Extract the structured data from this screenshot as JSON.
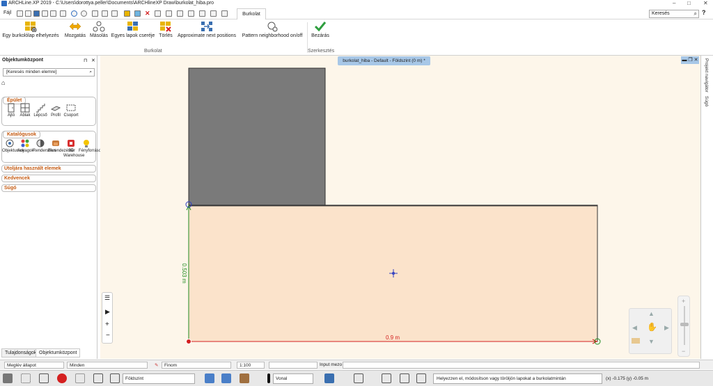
{
  "window": {
    "title": "ARCHLine.XP 2019 - C:\\Users\\dorottya.peller\\Documents\\ARCHlineXP Draw\\burkolat_hiba.pro",
    "min": "–",
    "max": "□",
    "close": "✕"
  },
  "quickbar": {
    "file_menu": "Fájl",
    "active_tab": "Burkolat",
    "search_placeholder": "Keresés",
    "help": "?"
  },
  "ribbon": {
    "buttons": [
      {
        "label": "Egy burkolólap elhelyezés",
        "icon": "tile-place-icon"
      },
      {
        "label": "Mozgatás",
        "icon": "move-arrows-icon"
      },
      {
        "label": "Másolás",
        "icon": "copy-nodes-icon"
      },
      {
        "label": "Egyes lapok cseréje",
        "icon": "tile-swap-icon"
      },
      {
        "label": "Törlés",
        "icon": "tile-delete-icon"
      },
      {
        "label": "Approximate next positions",
        "icon": "approx-positions-icon"
      },
      {
        "label": "Pattern neighborhood on/off",
        "icon": "pattern-toggle-icon"
      },
      {
        "label": "Bezárás",
        "icon": "checkmark-icon"
      }
    ],
    "group_burkolat": "Burkolat",
    "group_szerkesztes": "Szerkesztés"
  },
  "left_panel": {
    "title": "Objektumközpont",
    "pin": "⊓",
    "close": "✕",
    "search_placeholder": "[Keresés minden elemre]",
    "sections": {
      "epulet": "Épület",
      "katalogusok": "Katalógusok",
      "utoljara": "Utoljára használt elemek",
      "kedvencek": "Kedvencek",
      "sugo": "Súgó"
    },
    "epulet_items": [
      "Ajtó",
      "Ablak",
      "Lépcső",
      "Profil",
      "Csoport"
    ],
    "katalogus_items": [
      "Objektumok",
      "Anyagok",
      "Renderstílus",
      "Berendezéstér",
      "3D Warehouse",
      "Fényforrások"
    ],
    "bottom_tabs": [
      "Tulajdonságok",
      "Objektumközpont"
    ]
  },
  "document": {
    "tab_title": "burkolat_hiba - Default - Földszint (0 m) *",
    "ctrl": "▬ ❐ ✕"
  },
  "drawing": {
    "dim_vertical": "0.503 m",
    "dim_horizontal": "0.9 m"
  },
  "right_panel": {
    "tabs": [
      "Projekt navigátor",
      "Súgó"
    ]
  },
  "status_bar": {
    "layer_state": "Meglév állapot",
    "filter": "Minden",
    "line_weight": "Finom",
    "scale": "1:100",
    "input_label": "Input mezo",
    "input_value": ""
  },
  "bottom_bar": {
    "floor": "Földszint",
    "line_type": "Vonal",
    "hint": "Helyezzen el, módosítson vagy töröljön lapokat a burkolatmintán",
    "coords": "(x) -0.175   (y) -0.05 m"
  },
  "colors": {
    "canvas": "#fdf6ea",
    "tile_fill": "#fbe3cb",
    "dark_tile": "#7a7a7a",
    "dim_red": "#d42020",
    "dim_green": "#1e8a1e",
    "accent": "#2d6cc0"
  }
}
